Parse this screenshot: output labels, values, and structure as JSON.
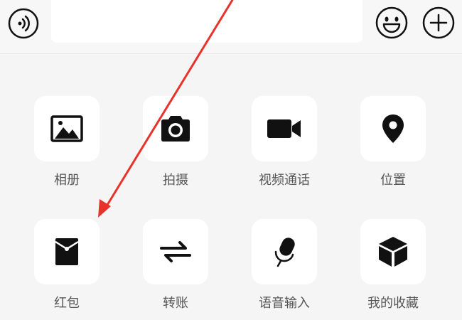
{
  "input_bar": {
    "voice_icon": "voice-wave-icon",
    "message_value": "",
    "emoji_icon": "smiley-face-icon",
    "more_icon": "plus-circle-icon"
  },
  "panel": {
    "items": [
      {
        "label": "相册",
        "icon": "image-icon"
      },
      {
        "label": "拍摄",
        "icon": "camera-icon"
      },
      {
        "label": "视频通话",
        "icon": "video-camera-icon"
      },
      {
        "label": "位置",
        "icon": "location-pin-icon"
      },
      {
        "label": "红包",
        "icon": "red-envelope-icon"
      },
      {
        "label": "转账",
        "icon": "transfer-arrows-icon"
      },
      {
        "label": "语音输入",
        "icon": "microphone-icon"
      },
      {
        "label": "我的收藏",
        "icon": "favorites-cube-icon"
      }
    ]
  },
  "annotation": {
    "color": "#e8332a"
  },
  "colors": {
    "background": "#f5f5f5",
    "tile": "#ffffff",
    "icon": "#111111",
    "label": "#555555"
  }
}
